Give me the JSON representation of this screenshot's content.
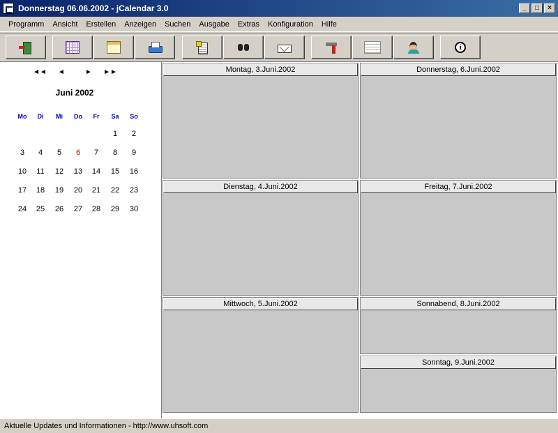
{
  "window": {
    "title": "Donnerstag 06.06.2002 - jCalendar 3.0",
    "minimize": "_",
    "maximize": "□",
    "close": "×"
  },
  "menu": [
    "Programm",
    "Ansicht",
    "Erstellen",
    "Anzeigen",
    "Suchen",
    "Ausgabe",
    "Extras",
    "Konfiguration",
    "Hilfe"
  ],
  "toolbar": {
    "icons": [
      "exit-icon",
      "month-view-icon",
      "day-view-icon",
      "print-icon",
      "new-appointment-icon",
      "search-icon",
      "mail-icon",
      "tools-icon",
      "list-icon",
      "contacts-icon",
      "info-icon"
    ],
    "info_glyph": "i"
  },
  "mini_calendar": {
    "nav": {
      "prev_year": "◄◄",
      "prev_month": "◄",
      "next_month": "►",
      "next_year": "►►"
    },
    "month_label": "Juni 2002",
    "weekdays": [
      "Mo",
      "Di",
      "Mi",
      "Do",
      "Fr",
      "Sa",
      "So"
    ],
    "weeks": [
      [
        "",
        "",
        "",
        "",
        "",
        "1",
        "2"
      ],
      [
        "3",
        "4",
        "5",
        "6",
        "7",
        "8",
        "9"
      ],
      [
        "10",
        "11",
        "12",
        "13",
        "14",
        "15",
        "16"
      ],
      [
        "17",
        "18",
        "19",
        "20",
        "21",
        "22",
        "23"
      ],
      [
        "24",
        "25",
        "26",
        "27",
        "28",
        "29",
        "30"
      ]
    ],
    "today": "6",
    "today_color": "#d00000",
    "weekday_color": "#0000d0"
  },
  "week": {
    "days": [
      "Montag, 3.Juni.2002",
      "Dienstag, 4.Juni.2002",
      "Mittwoch, 5.Juni.2002",
      "Donnerstag, 6.Juni.2002",
      "Freitag, 7.Juni.2002",
      "Sonnabend, 8.Juni.2002",
      "Sonntag, 9.Juni.2002"
    ]
  },
  "status": "Aktuelle Updates und Informationen - http://www.uhsoft.com"
}
